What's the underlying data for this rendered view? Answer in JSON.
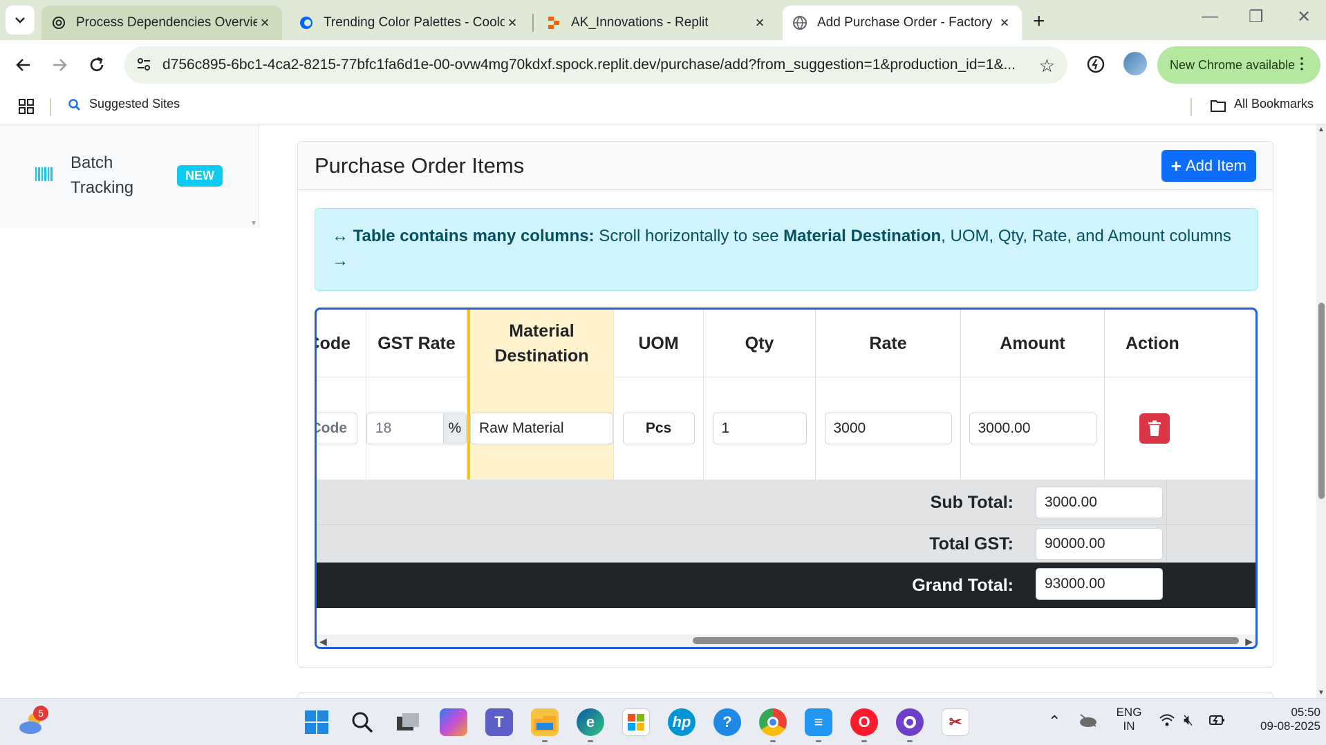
{
  "browser": {
    "tabs": [
      {
        "title": "Process Dependencies Overview",
        "icon": "openai-icon"
      },
      {
        "title": "Trending Color Palettes - Coolors",
        "icon": "coolors-icon"
      },
      {
        "title": "AK_Innovations - Replit",
        "icon": "replit-icon"
      },
      {
        "title": "Add Purchase Order - Factory Manager",
        "icon": "globe-icon",
        "active": true
      }
    ],
    "url": "d756c895-6bc1-4ca2-8215-77bfc1fa6d1e-00-ovw4mg70kdxf.spock.replit.dev/purchase/add?from_suggestion=1&production_id=1&...",
    "new_chrome_label": "New Chrome available",
    "bookmarks": {
      "suggested": "Suggested Sites",
      "all": "All Bookmarks"
    }
  },
  "sidebar": {
    "item_label_line1": "Batch",
    "item_label_line2": "Tracking",
    "badge": "NEW"
  },
  "card": {
    "title": "Purchase Order Items",
    "add_button": "Add Item"
  },
  "alert": {
    "arrows": "↔",
    "bold_lead": "Table contains many columns:",
    "text_1": " Scroll horizontally to see ",
    "bold_mid": "Material Destination",
    "text_2": ", UOM, Qty, Rate, and Amount columns",
    "trailing_arrow": "→"
  },
  "table": {
    "headers": {
      "code": "Code",
      "gst_rate": "GST Rate",
      "destination_line1": "Material",
      "destination_line2": "Destination",
      "uom": "UOM",
      "qty": "Qty",
      "rate": "Rate",
      "amount": "Amount",
      "action": "Action"
    },
    "row": {
      "code": "Code",
      "gst_rate": "18",
      "gst_suffix": "%",
      "destination": "Raw Material",
      "uom": "Pcs",
      "qty": "1",
      "rate": "3000",
      "amount": "3000.00"
    },
    "totals": {
      "sub_total_label": "Sub Total:",
      "sub_total": "3000.00",
      "total_gst_label": "Total GST:",
      "total_gst": "90000.00",
      "grand_total_label": "Grand Total:",
      "grand_total": "93000.00"
    }
  },
  "taskbar": {
    "weather_badge": "5",
    "lang_line1": "ENG",
    "lang_line2": "IN",
    "time": "05:50",
    "date": "09-08-2025"
  },
  "colors": {
    "primary": "#0d6efd",
    "danger": "#dc3545",
    "info_bg": "#cff4fc",
    "highlight_col": "#fff3cd",
    "table_border": "#1f5fd8"
  }
}
